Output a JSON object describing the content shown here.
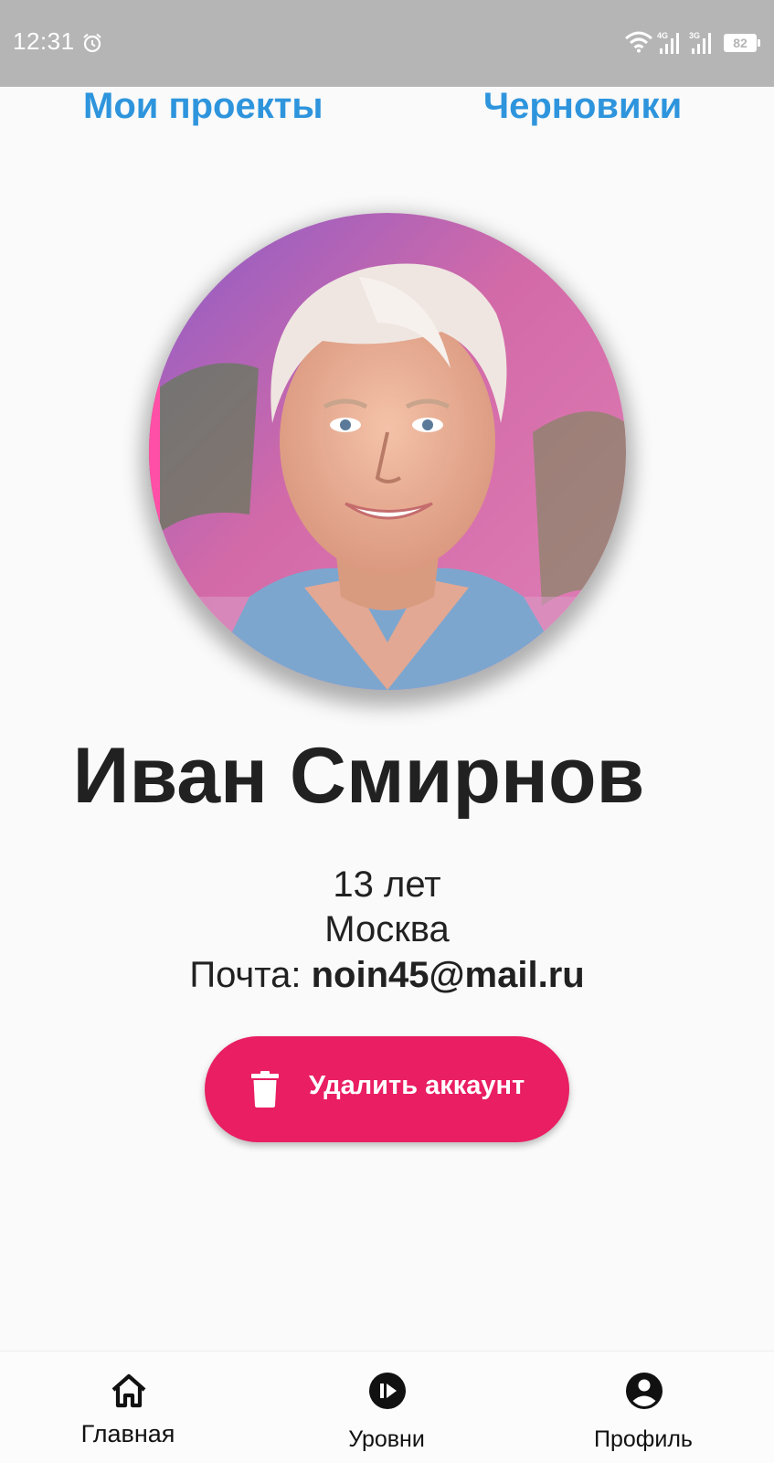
{
  "status_bar": {
    "time": "12:31",
    "battery": "82",
    "network_labels": [
      "4G",
      "3G"
    ]
  },
  "tabs": {
    "projects": "Мои проекты",
    "drafts": "Черновики"
  },
  "profile": {
    "name": "Иван Смирнов",
    "age": "13 лет",
    "city": "Москва",
    "email_label": "Почта: ",
    "email": "noin45@mail.ru"
  },
  "delete_button": {
    "label": "Удалить аккаунт",
    "icon": "trash-icon"
  },
  "bottom_nav": {
    "items": [
      {
        "label": "Главная",
        "icon": "home-icon"
      },
      {
        "label": "Уровни",
        "icon": "play-circle-icon"
      },
      {
        "label": "Профиль",
        "icon": "account-circle-icon"
      }
    ]
  },
  "colors": {
    "accent_blue": "#2e95dd",
    "danger_pink": "#e91e63",
    "status_bar_gray": "#b5b5b5",
    "text_dark": "#212121"
  }
}
